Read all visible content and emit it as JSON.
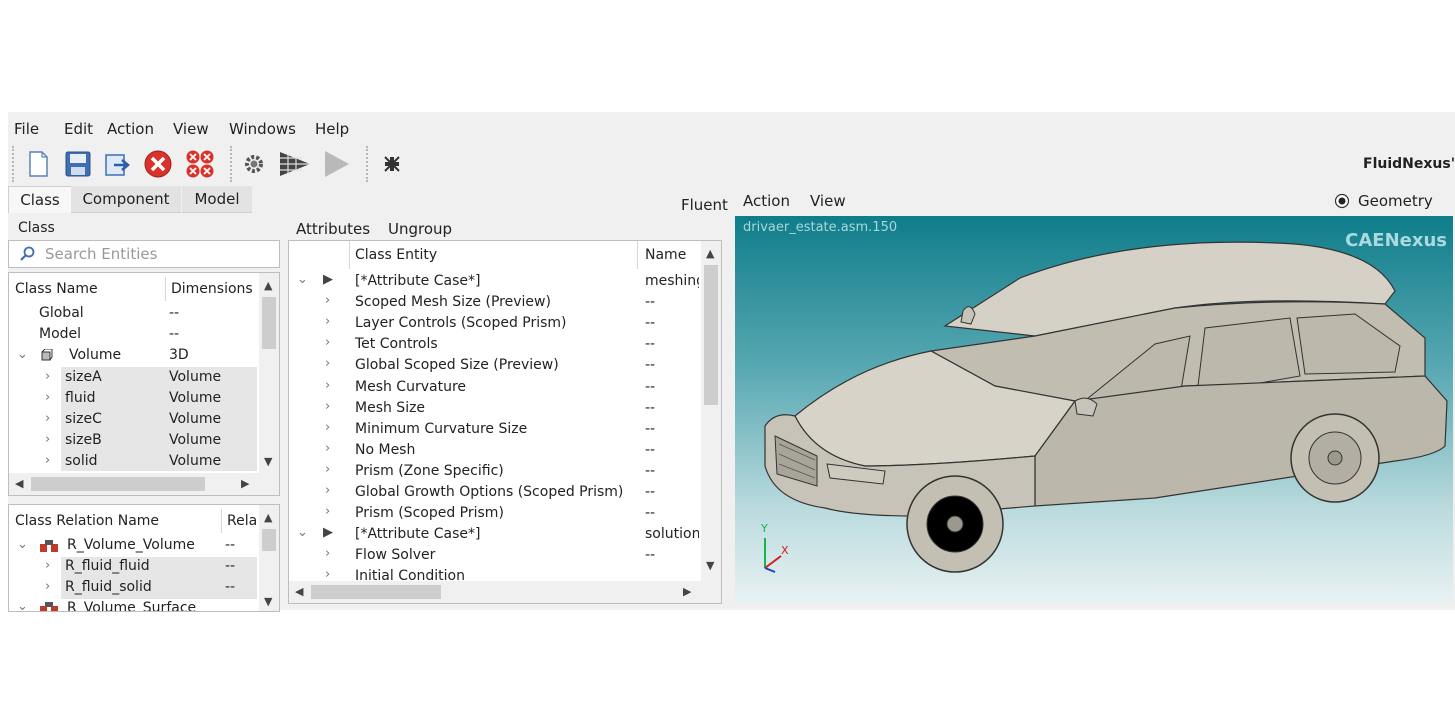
{
  "menu": [
    "File",
    "Edit",
    "Action",
    "View",
    "Windows",
    "Help"
  ],
  "brand": "FluidNexus'",
  "left_tabs": [
    "Class",
    "Component",
    "Model"
  ],
  "class_label": "Class",
  "search_placeholder": "Search Entities",
  "class_table": {
    "headers": [
      "Class Name",
      "Dimensions"
    ],
    "rows": [
      {
        "name": "Global",
        "dim": "--"
      },
      {
        "name": "Model",
        "dim": "--"
      },
      {
        "name": "Volume",
        "dim": "3D"
      },
      {
        "name": "sizeA",
        "dim": "Volume"
      },
      {
        "name": "fluid",
        "dim": "Volume"
      },
      {
        "name": "sizeC",
        "dim": "Volume"
      },
      {
        "name": "sizeB",
        "dim": "Volume"
      },
      {
        "name": "solid",
        "dim": "Volume"
      }
    ]
  },
  "relation_table": {
    "headers": [
      "Class Relation Name",
      "Rela"
    ],
    "rows": [
      {
        "name": "R_Volume_Volume",
        "val": "--"
      },
      {
        "name": "R_fluid_fluid",
        "val": "--"
      },
      {
        "name": "R_fluid_solid",
        "val": "--"
      },
      {
        "name": "R_Volume_Surface",
        "val": ""
      }
    ]
  },
  "middle": {
    "fluent_label": "Fluent",
    "toolbar": [
      "Attributes",
      "Ungroup"
    ],
    "headers": [
      "Class Entity",
      "Name"
    ],
    "rows": [
      {
        "label": "[*Attribute Case*]",
        "name": "meshing",
        "type": "case"
      },
      {
        "label": "Scoped Mesh Size (Preview)",
        "name": "--",
        "type": "item"
      },
      {
        "label": "Layer Controls (Scoped Prism)",
        "name": "--",
        "type": "item"
      },
      {
        "label": "Tet Controls",
        "name": "--",
        "type": "item"
      },
      {
        "label": "Global Scoped Size (Preview)",
        "name": "--",
        "type": "item"
      },
      {
        "label": "Mesh Curvature",
        "name": "--",
        "type": "item"
      },
      {
        "label": "Mesh Size",
        "name": "--",
        "type": "item"
      },
      {
        "label": "Minimum Curvature Size",
        "name": "--",
        "type": "item"
      },
      {
        "label": "No Mesh",
        "name": "--",
        "type": "item"
      },
      {
        "label": "Prism (Zone Specific)",
        "name": "--",
        "type": "item"
      },
      {
        "label": "Global Growth Options (Scoped Prism)",
        "name": "--",
        "type": "item"
      },
      {
        "label": "Prism (Scoped Prism)",
        "name": "--",
        "type": "item"
      },
      {
        "label": "[*Attribute Case*]",
        "name": "solution",
        "type": "case"
      },
      {
        "label": "Flow Solver",
        "name": "--",
        "type": "item"
      },
      {
        "label": "Initial Condition",
        "name": "",
        "type": "item"
      }
    ]
  },
  "viewport": {
    "menu": [
      "Action",
      "View"
    ],
    "radio_label": "Geometry",
    "filename": "drivaer_estate.asm.150",
    "watermark": "CAENexus",
    "axis_y": "Y",
    "axis_x": "X"
  }
}
